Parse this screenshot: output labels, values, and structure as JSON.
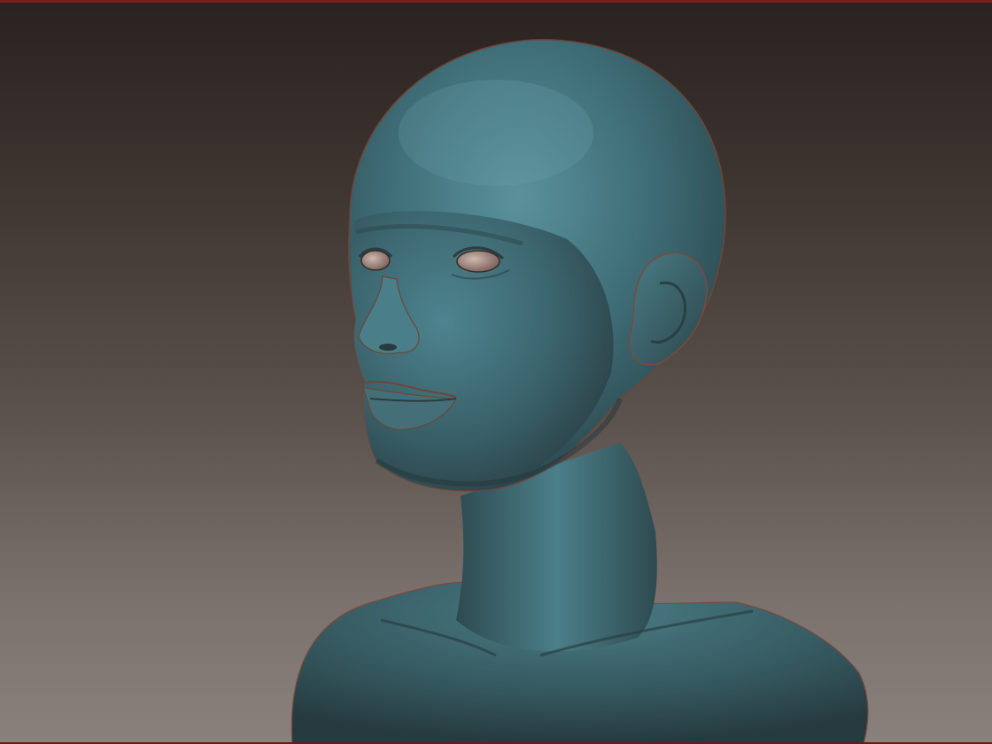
{
  "scene": {
    "subject": "sculpted-head-bust",
    "colors": {
      "background_top": "#2a2220",
      "background_bottom": "#8a807c",
      "frame_accent": "#7a1f1c",
      "material_light": "#4f8590",
      "material_mid": "#3c6670",
      "material_dark": "#2a3f45",
      "rim_warm": "#8a5a4a",
      "eye_highlight": "#b8a098"
    }
  }
}
